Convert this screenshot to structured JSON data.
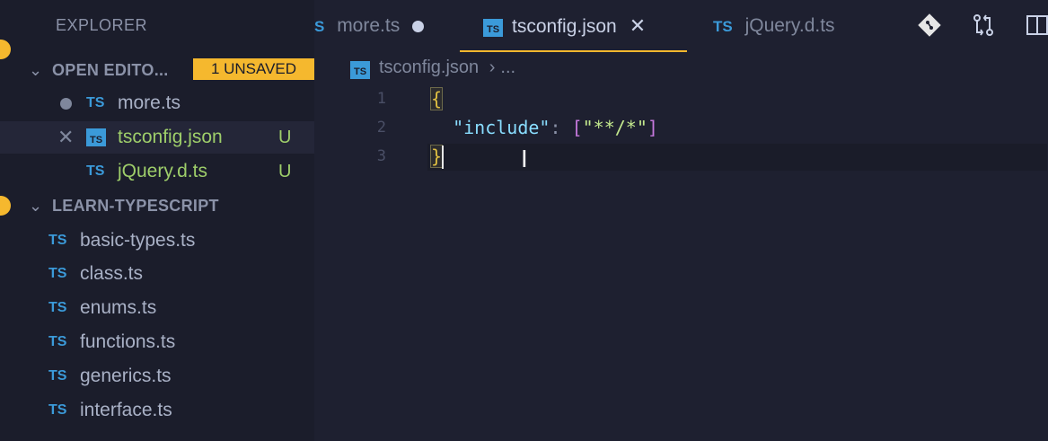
{
  "sidebar": {
    "title": "EXPLORER",
    "open_editors": {
      "header": "OPEN EDITO...",
      "badge": "1 UNSAVED",
      "items": [
        {
          "icon": "TS",
          "label": "more.ts",
          "status": ""
        },
        {
          "icon": "TS",
          "label": "tsconfig.json",
          "status": "U"
        },
        {
          "icon": "TS",
          "label": "jQuery.d.ts",
          "status": "U"
        }
      ]
    },
    "project": {
      "header": "LEARN-TYPESCRIPT",
      "files": [
        {
          "icon": "TS",
          "label": "basic-types.ts"
        },
        {
          "icon": "TS",
          "label": "class.ts"
        },
        {
          "icon": "TS",
          "label": "enums.ts"
        },
        {
          "icon": "TS",
          "label": "functions.ts"
        },
        {
          "icon": "TS",
          "label": "generics.ts"
        },
        {
          "icon": "TS",
          "label": "interface.ts"
        }
      ]
    }
  },
  "tabs": [
    {
      "icon": "S",
      "label": "more.ts"
    },
    {
      "icon": "TS",
      "label": "tsconfig.json"
    },
    {
      "icon": "TS",
      "label": "jQuery.d.ts"
    }
  ],
  "breadcrumb": {
    "icon": "TS",
    "file": "tsconfig.json",
    "rest": "..."
  },
  "editor": {
    "line_numbers": [
      "1",
      "2",
      "3"
    ],
    "lines": {
      "l1_brace": "{",
      "l2_key": "\"include\"",
      "l2_colon": ": ",
      "l2_open": "[",
      "l2_value": "\"**/*\"",
      "l2_close": "]",
      "l3_brace": "}"
    }
  },
  "colors": {
    "accent": "#f5b82e",
    "ts_blue": "#3b9ad9",
    "untracked": "#9ece6a"
  },
  "icons": {
    "toolbar": [
      "git-icon",
      "compare-changes-icon",
      "split-editor-icon"
    ],
    "misc": [
      "chevron-down-icon",
      "close-icon",
      "modified-dot-icon",
      "text-cursor-icon"
    ]
  }
}
